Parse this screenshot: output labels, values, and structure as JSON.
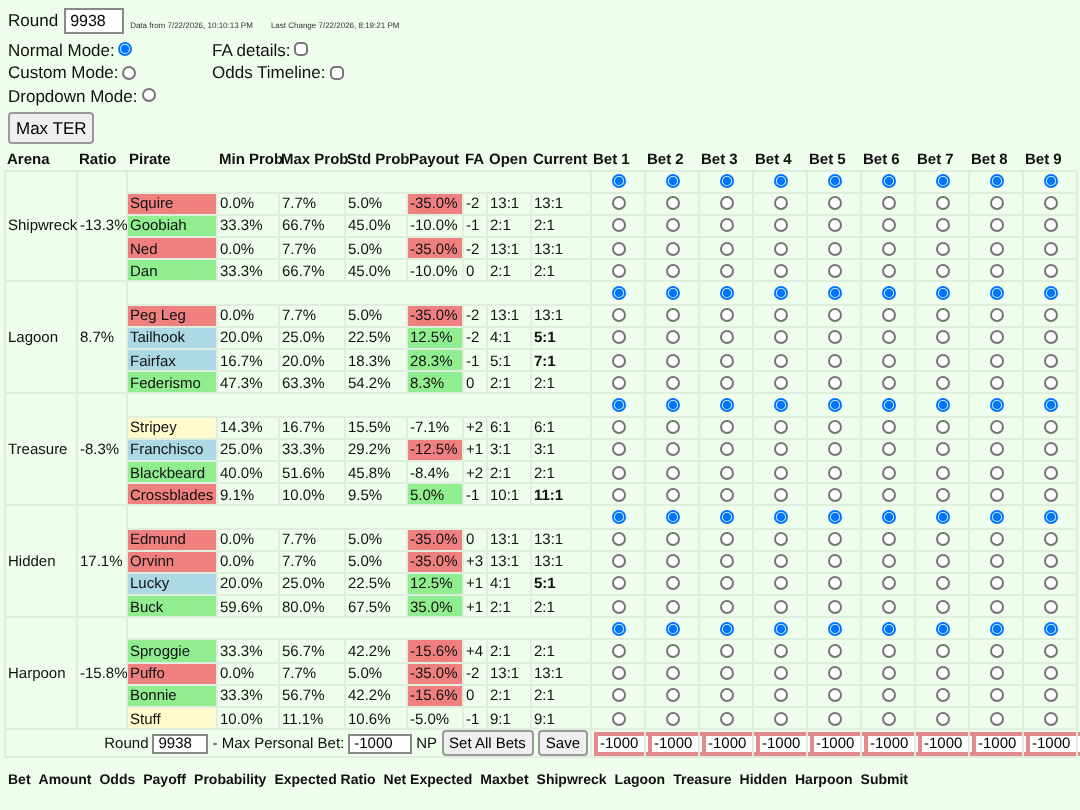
{
  "header": {
    "round_label": "Round",
    "round": "9938",
    "data_from": "Data from 7/22/2026, 10:10:13 PM",
    "last_change": "Last Change 7/22/2026, 8:19:21 PM",
    "modes": [
      {
        "label": "Normal Mode:",
        "selected": true
      },
      {
        "label": "Custom Mode:",
        "selected": false
      },
      {
        "label": "Dropdown Mode:",
        "selected": false
      }
    ],
    "options": [
      {
        "label": "FA details:",
        "checked": false
      },
      {
        "label": "Odds Timeline:",
        "checked": false
      }
    ],
    "button": "Max TER"
  },
  "table": {
    "columns": [
      "Arena",
      "Ratio",
      "Pirate",
      "Min Prob",
      "Max Prob",
      "Std Prob",
      "Payout",
      "FA",
      "Open",
      "Current",
      "Bet 1",
      "Bet 2",
      "Bet 3",
      "Bet 4",
      "Bet 5",
      "Bet 6",
      "Bet 7",
      "Bet 8",
      "Bet 9"
    ],
    "arenas": [
      {
        "name": "Shipwreck",
        "ratio": "-13.3%",
        "none_row": [
          true,
          true,
          true,
          true,
          true,
          true,
          true,
          true,
          true
        ],
        "pirates": [
          {
            "name": "Squire",
            "color": "#f08080",
            "min": "0.0%",
            "max": "7.7%",
            "std": "5.0%",
            "payout": {
              "text": "-35.0%",
              "color": "#f08080"
            },
            "fa": "-2",
            "open": "13:1",
            "current": "13:1",
            "odds_changed": false,
            "bets": [
              false,
              false,
              false,
              false,
              false,
              false,
              false,
              false,
              false
            ]
          },
          {
            "name": "Goobiah",
            "color": "#90ee90",
            "min": "33.3%",
            "max": "66.7%",
            "std": "45.0%",
            "payout": {
              "text": "-10.0%"
            },
            "fa": "-1",
            "open": "2:1",
            "current": "2:1",
            "odds_changed": false,
            "bets": [
              false,
              false,
              false,
              false,
              false,
              false,
              false,
              false,
              false
            ]
          },
          {
            "name": "Ned",
            "color": "#f08080",
            "min": "0.0%",
            "max": "7.7%",
            "std": "5.0%",
            "payout": {
              "text": "-35.0%",
              "color": "#f08080"
            },
            "fa": "-2",
            "open": "13:1",
            "current": "13:1",
            "odds_changed": false,
            "bets": [
              false,
              false,
              false,
              false,
              false,
              false,
              false,
              false,
              false
            ]
          },
          {
            "name": "Dan",
            "color": "#90ee90",
            "min": "33.3%",
            "max": "66.7%",
            "std": "45.0%",
            "payout": {
              "text": "-10.0%"
            },
            "fa": "0",
            "open": "2:1",
            "current": "2:1",
            "odds_changed": false,
            "bets": [
              false,
              false,
              false,
              false,
              false,
              false,
              false,
              false,
              false
            ]
          }
        ]
      },
      {
        "name": "Lagoon",
        "ratio": "8.7%",
        "none_row": [
          true,
          true,
          true,
          true,
          true,
          true,
          true,
          true,
          true
        ],
        "pirates": [
          {
            "name": "Peg Leg",
            "color": "#f08080",
            "min": "0.0%",
            "max": "7.7%",
            "std": "5.0%",
            "payout": {
              "text": "-35.0%",
              "color": "#f08080"
            },
            "fa": "-2",
            "open": "13:1",
            "current": "13:1",
            "odds_changed": false,
            "bets": [
              false,
              false,
              false,
              false,
              false,
              false,
              false,
              false,
              false
            ]
          },
          {
            "name": "Tailhook",
            "color": "#add8e6",
            "min": "20.0%",
            "max": "25.0%",
            "std": "22.5%",
            "payout": {
              "text": "12.5%",
              "color": "#90ee90"
            },
            "fa": "-2",
            "open": "4:1",
            "current": "5:1",
            "odds_changed": true,
            "bets": [
              false,
              false,
              false,
              false,
              false,
              false,
              false,
              false,
              false
            ]
          },
          {
            "name": "Fairfax",
            "color": "#add8e6",
            "min": "16.7%",
            "max": "20.0%",
            "std": "18.3%",
            "payout": {
              "text": "28.3%",
              "color": "#90ee90"
            },
            "fa": "-1",
            "open": "5:1",
            "current": "7:1",
            "odds_changed": true,
            "bets": [
              false,
              false,
              false,
              false,
              false,
              false,
              false,
              false,
              false
            ]
          },
          {
            "name": "Federismo",
            "color": "#90ee90",
            "min": "47.3%",
            "max": "63.3%",
            "std": "54.2%",
            "payout": {
              "text": "8.3%",
              "color": "#90ee90"
            },
            "fa": "0",
            "open": "2:1",
            "current": "2:1",
            "odds_changed": false,
            "bets": [
              false,
              false,
              false,
              false,
              false,
              false,
              false,
              false,
              false
            ]
          }
        ]
      },
      {
        "name": "Treasure",
        "ratio": "-8.3%",
        "none_row": [
          true,
          true,
          true,
          true,
          true,
          true,
          true,
          true,
          true
        ],
        "pirates": [
          {
            "name": "Stripey",
            "color": "#fffacd",
            "min": "14.3%",
            "max": "16.7%",
            "std": "15.5%",
            "payout": {
              "text": "-7.1%"
            },
            "fa": "+2",
            "open": "6:1",
            "current": "6:1",
            "odds_changed": false,
            "bets": [
              false,
              false,
              false,
              false,
              false,
              false,
              false,
              false,
              false
            ]
          },
          {
            "name": "Franchisco",
            "color": "#add8e6",
            "min": "25.0%",
            "max": "33.3%",
            "std": "29.2%",
            "payout": {
              "text": "-12.5%",
              "color": "#f08080"
            },
            "fa": "+1",
            "open": "3:1",
            "current": "3:1",
            "odds_changed": false,
            "bets": [
              false,
              false,
              false,
              false,
              false,
              false,
              false,
              false,
              false
            ]
          },
          {
            "name": "Blackbeard",
            "color": "#90ee90",
            "min": "40.0%",
            "max": "51.6%",
            "std": "45.8%",
            "payout": {
              "text": "-8.4%"
            },
            "fa": "+2",
            "open": "2:1",
            "current": "2:1",
            "odds_changed": false,
            "bets": [
              false,
              false,
              false,
              false,
              false,
              false,
              false,
              false,
              false
            ]
          },
          {
            "name": "Crossblades",
            "color": "#f08080",
            "min": "9.1%",
            "max": "10.0%",
            "std": "9.5%",
            "payout": {
              "text": "5.0%",
              "color": "#90ee90"
            },
            "fa": "-1",
            "open": "10:1",
            "current": "11:1",
            "odds_changed": true,
            "bets": [
              false,
              false,
              false,
              false,
              false,
              false,
              false,
              false,
              false
            ]
          }
        ]
      },
      {
        "name": "Hidden",
        "ratio": "17.1%",
        "none_row": [
          true,
          true,
          true,
          true,
          true,
          true,
          true,
          true,
          true
        ],
        "pirates": [
          {
            "name": "Edmund",
            "color": "#f08080",
            "min": "0.0%",
            "max": "7.7%",
            "std": "5.0%",
            "payout": {
              "text": "-35.0%",
              "color": "#f08080"
            },
            "fa": "0",
            "open": "13:1",
            "current": "13:1",
            "odds_changed": false,
            "bets": [
              false,
              false,
              false,
              false,
              false,
              false,
              false,
              false,
              false
            ]
          },
          {
            "name": "Orvinn",
            "color": "#f08080",
            "min": "0.0%",
            "max": "7.7%",
            "std": "5.0%",
            "payout": {
              "text": "-35.0%",
              "color": "#f08080"
            },
            "fa": "+3",
            "open": "13:1",
            "current": "13:1",
            "odds_changed": false,
            "bets": [
              false,
              false,
              false,
              false,
              false,
              false,
              false,
              false,
              false
            ]
          },
          {
            "name": "Lucky",
            "color": "#add8e6",
            "min": "20.0%",
            "max": "25.0%",
            "std": "22.5%",
            "payout": {
              "text": "12.5%",
              "color": "#90ee90"
            },
            "fa": "+1",
            "open": "4:1",
            "current": "5:1",
            "odds_changed": true,
            "bets": [
              false,
              false,
              false,
              false,
              false,
              false,
              false,
              false,
              false
            ]
          },
          {
            "name": "Buck",
            "color": "#90ee90",
            "min": "59.6%",
            "max": "80.0%",
            "std": "67.5%",
            "payout": {
              "text": "35.0%",
              "color": "#90ee90"
            },
            "fa": "+1",
            "open": "2:1",
            "current": "2:1",
            "odds_changed": false,
            "bets": [
              false,
              false,
              false,
              false,
              false,
              false,
              false,
              false,
              false
            ]
          }
        ]
      },
      {
        "name": "Harpoon",
        "ratio": "-15.8%",
        "none_row": [
          true,
          true,
          true,
          true,
          true,
          true,
          true,
          true,
          true
        ],
        "pirates": [
          {
            "name": "Sproggie",
            "color": "#90ee90",
            "min": "33.3%",
            "max": "56.7%",
            "std": "42.2%",
            "payout": {
              "text": "-15.6%",
              "color": "#f08080"
            },
            "fa": "+4",
            "open": "2:1",
            "current": "2:1",
            "odds_changed": false,
            "bets": [
              false,
              false,
              false,
              false,
              false,
              false,
              false,
              false,
              false
            ]
          },
          {
            "name": "Puffo",
            "color": "#f08080",
            "min": "0.0%",
            "max": "7.7%",
            "std": "5.0%",
            "payout": {
              "text": "-35.0%",
              "color": "#f08080"
            },
            "fa": "-2",
            "open": "13:1",
            "current": "13:1",
            "odds_changed": false,
            "bets": [
              false,
              false,
              false,
              false,
              false,
              false,
              false,
              false,
              false
            ]
          },
          {
            "name": "Bonnie",
            "color": "#90ee90",
            "min": "33.3%",
            "max": "56.7%",
            "std": "42.2%",
            "payout": {
              "text": "-15.6%",
              "color": "#f08080"
            },
            "fa": "0",
            "open": "2:1",
            "current": "2:1",
            "odds_changed": false,
            "bets": [
              false,
              false,
              false,
              false,
              false,
              false,
              false,
              false,
              false
            ]
          },
          {
            "name": "Stuff",
            "color": "#fffacd",
            "min": "10.0%",
            "max": "11.1%",
            "std": "10.6%",
            "payout": {
              "text": "-5.0%"
            },
            "fa": "-1",
            "open": "9:1",
            "current": "9:1",
            "odds_changed": false,
            "bets": [
              false,
              false,
              false,
              false,
              false,
              false,
              false,
              false,
              false
            ]
          }
        ]
      }
    ],
    "footer": {
      "round_label": "Round",
      "round": "9938",
      "max_label": "- Max Personal Bet:",
      "max_value": "-1000",
      "unit": "NP",
      "buttons": [
        "Set All Bets",
        "Save"
      ],
      "bet_amounts": [
        "-1000",
        "-1000",
        "-1000",
        "-1000",
        "-1000",
        "-1000",
        "-1000",
        "-1000",
        "-1000"
      ]
    }
  },
  "summary": {
    "columns": [
      "Bet",
      "Amount",
      "Odds",
      "Payoff",
      "Probability",
      "Expected Ratio",
      "Net Expected",
      "Maxbet",
      "Shipwreck",
      "Lagoon",
      "Treasure",
      "Hidden",
      "Harpoon",
      "Submit"
    ]
  }
}
